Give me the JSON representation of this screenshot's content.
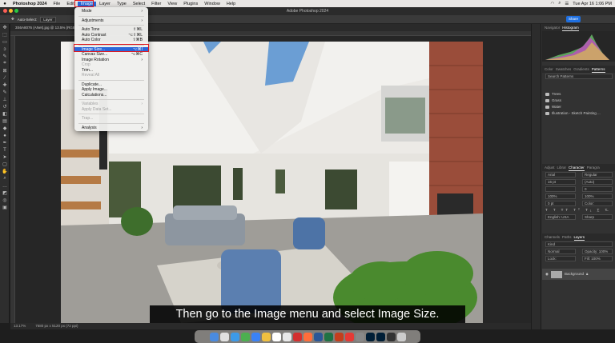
{
  "menubar": {
    "app": "Photoshop 2024",
    "items": [
      "File",
      "Edit",
      "Image",
      "Layer",
      "Type",
      "Select",
      "Filter",
      "View",
      "Plugins",
      "Window",
      "Help"
    ],
    "clock": "Tue Apr 16  1:06 PM"
  },
  "window": {
    "title": "Adobe Photoshop 2024"
  },
  "options": {
    "auto_select": "Auto-Select:",
    "layer": "Layer"
  },
  "share": "Share",
  "document": {
    "tab": "3S6A8076 (ANet).jpg @ 13.5% (RGB/8)",
    "zoom": "13.17%",
    "size": "7680 px x 5120 px (72 ppi)"
  },
  "image_menu": {
    "items": [
      {
        "label": "Mode",
        "shortcut": "›",
        "disabled": false,
        "sep_after": true
      },
      {
        "label": "Adjustments",
        "shortcut": "›",
        "disabled": false,
        "sep_after": true
      },
      {
        "label": "Auto Tone",
        "shortcut": "⇧⌘L",
        "disabled": false,
        "sep_after": false
      },
      {
        "label": "Auto Contrast",
        "shortcut": "⌥⇧⌘L",
        "disabled": false,
        "sep_after": false
      },
      {
        "label": "Auto Color",
        "shortcut": "⇧⌘B",
        "disabled": false,
        "sep_after": true
      },
      {
        "label": "Image Size...",
        "shortcut": "⌥⌘I",
        "disabled": false,
        "sep_after": false,
        "highlight": true
      },
      {
        "label": "Canvas Size...",
        "shortcut": "⌥⌘C",
        "disabled": false,
        "sep_after": false
      },
      {
        "label": "Image Rotation",
        "shortcut": "›",
        "disabled": false,
        "sep_after": false
      },
      {
        "label": "Crop",
        "shortcut": "",
        "disabled": true,
        "sep_after": false
      },
      {
        "label": "Trim...",
        "shortcut": "",
        "disabled": false,
        "sep_after": false
      },
      {
        "label": "Reveal All",
        "shortcut": "",
        "disabled": true,
        "sep_after": true
      },
      {
        "label": "Duplicate...",
        "shortcut": "",
        "disabled": false,
        "sep_after": false
      },
      {
        "label": "Apply Image...",
        "shortcut": "",
        "disabled": false,
        "sep_after": false
      },
      {
        "label": "Calculations...",
        "shortcut": "",
        "disabled": false,
        "sep_after": true
      },
      {
        "label": "Variables",
        "shortcut": "›",
        "disabled": true,
        "sep_after": false
      },
      {
        "label": "Apply Data Set...",
        "shortcut": "",
        "disabled": true,
        "sep_after": true
      },
      {
        "label": "Trap...",
        "shortcut": "",
        "disabled": true,
        "sep_after": true
      },
      {
        "label": "Analysis",
        "shortcut": "›",
        "disabled": false,
        "sep_after": false
      }
    ]
  },
  "subtitle": "Then go to the Image menu and select Image Size.",
  "panels": {
    "top_tabs": [
      "Navigator",
      "Histogram"
    ],
    "mid_tabs": [
      "Color",
      "Swatches",
      "Gradients",
      "Patterns"
    ],
    "search_placeholder": "Search Patterns",
    "patterns": [
      "Trees",
      "Grass",
      "Water",
      "Illustration - Sketch Painting ..."
    ],
    "char_tabs": [
      "Adjust",
      "Librar",
      "Character",
      "Paragra"
    ],
    "font": "Arial",
    "font_style": "Regular",
    "font_size": "16 pt",
    "leading": "(Auto)",
    "tracking": "0",
    "scale_v": "100%",
    "scale_h": "100%",
    "baseline": "0 pt",
    "color_label": "Color:",
    "language": "English: USA",
    "aa": "Sharp",
    "layer_tabs": [
      "Channels",
      "Paths",
      "Layers"
    ],
    "kind_label": "Kind",
    "blend": "Normal",
    "opacity": "Opacity: 100%",
    "lock": "Lock:",
    "fill": "Fill: 100%",
    "layer_name": "Background"
  },
  "colors": {
    "accent": "#2a66d9",
    "highlight": "#e0171e"
  }
}
